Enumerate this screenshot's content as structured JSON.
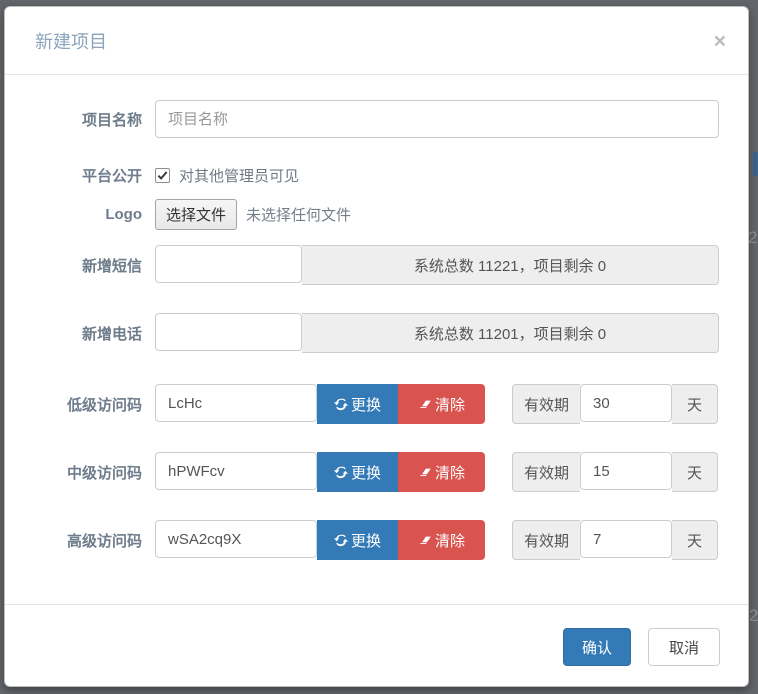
{
  "modal": {
    "title": "新建项目",
    "close_icon": "close-icon"
  },
  "form": {
    "project_name": {
      "label": "项目名称",
      "placeholder": "项目名称",
      "value": ""
    },
    "platform_public": {
      "label": "平台公开",
      "checkbox_label": "对其他管理员可见",
      "checked": true
    },
    "logo": {
      "label": "Logo",
      "button": "选择文件",
      "status": "未选择任何文件"
    },
    "sms": {
      "label": "新增短信",
      "value": "",
      "addon": "系统总数 11221，项目剩余 0"
    },
    "phone": {
      "label": "新增电话",
      "value": "",
      "addon": "系统总数 11201，项目剩余 0"
    },
    "access_codes": [
      {
        "label": "低级访问码",
        "value": "LcHc",
        "replace": "更换",
        "clear": "清除",
        "validity_label": "有效期",
        "validity_value": "30",
        "unit": "天"
      },
      {
        "label": "中级访问码",
        "value": "hPWFcv",
        "replace": "更换",
        "clear": "清除",
        "validity_label": "有效期",
        "validity_value": "15",
        "unit": "天"
      },
      {
        "label": "高级访问码",
        "value": "wSA2cq9X",
        "replace": "更换",
        "clear": "清除",
        "validity_label": "有效期",
        "validity_value": "7",
        "unit": "天"
      }
    ]
  },
  "footer": {
    "confirm": "确认",
    "cancel": "取消"
  },
  "icons": {
    "replace": "refresh-icon",
    "clear": "eraser-icon",
    "checkbox": "checkmark-icon"
  },
  "colors": {
    "primary": "#337ab7",
    "danger": "#d9534f",
    "title": "#8ca3bb",
    "addon_bg": "#eeeeee",
    "backdrop": "#63676b"
  },
  "backdrop_artifacts": {
    "digit_top": "2",
    "digit_bottom": "2"
  }
}
